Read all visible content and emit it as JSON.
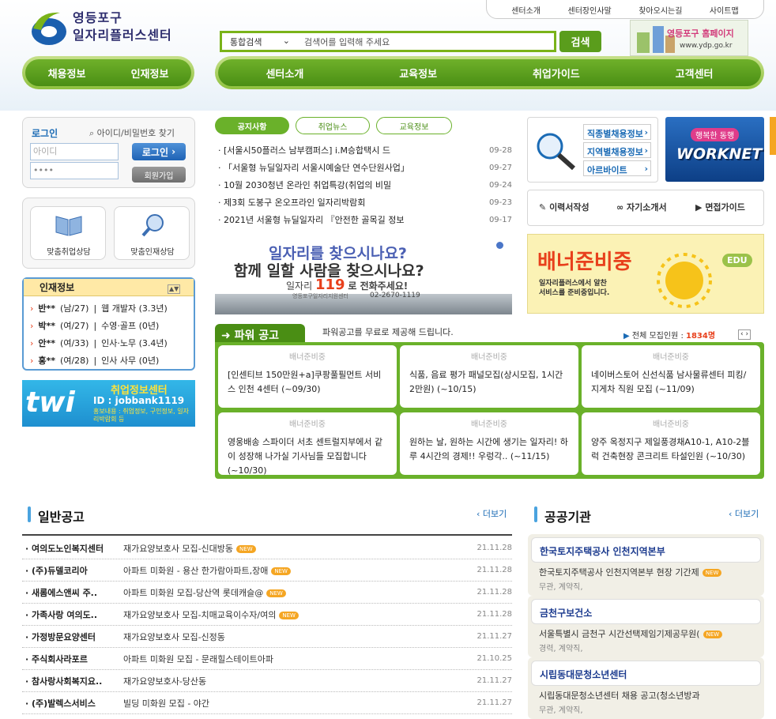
{
  "top_links": [
    "센터소개",
    "센터장인사말",
    "찾아오시는길",
    "사이트맵"
  ],
  "logo": {
    "line1": "영등포구",
    "line2": "일자리플러스센터"
  },
  "search": {
    "scope": "통합검색",
    "placeholder": "검색어를 입력해 주세요",
    "button": "검색"
  },
  "ydp_banner": {
    "title": "영등포구 홈페이지",
    "url": "www.ydp.go.kr"
  },
  "left_nav": [
    "채용정보",
    "인재정보"
  ],
  "main_nav": [
    "센터소개",
    "교육정보",
    "취업가이드",
    "고객센터"
  ],
  "login": {
    "title": "로그인",
    "find": "아이디/비밀번호 찾기",
    "id_placeholder": "아이디",
    "pw_value": "••••",
    "login_btn": "로그인",
    "join_btn": "회원가입"
  },
  "quick": [
    {
      "label": "맞춤취업상담"
    },
    {
      "label": "맞춤인재상담"
    }
  ],
  "talent": {
    "title": "인재정보",
    "items": [
      {
        "name": "반**",
        "info": "(남/27)",
        "job": "웹 개발자 (3.3년)"
      },
      {
        "name": "박**",
        "info": "(여/27)",
        "job": "수영·골프 (0년)"
      },
      {
        "name": "안**",
        "info": "(여/33)",
        "job": "인사·노무 (3.4년)"
      },
      {
        "name": "홍**",
        "info": "(여/28)",
        "job": "인사 사무 (0년)"
      }
    ]
  },
  "twitter_banner": {
    "line1": "취업정보센터",
    "line2": "ID : jobbank1119",
    "line3": "홍보내용 : 취업정보, 구인정보, 일자리박람회 등",
    "logo": "twi"
  },
  "news_tabs": [
    "공지사항",
    "취업뉴스",
    "교육정보"
  ],
  "news": [
    {
      "title": "[서울시50플러스 남부캠퍼스] i.M승합택시 드",
      "date": "09-28"
    },
    {
      "title": "「서울형 뉴딜일자리 서울시예술단 연수단원사업」",
      "date": "09-27"
    },
    {
      "title": "10월 2030청년 온라인 취업특강(취업의 비밀",
      "date": "09-24"
    },
    {
      "title": "제3회 도봉구 온오프라인 일자리박람회",
      "date": "09-23"
    },
    {
      "title": "2021년 서울형 뉴딜일자리 『안전한 골목길 정보",
      "date": "09-17"
    }
  ],
  "center_banner": {
    "line1": "일자리를 찾으시나요?",
    "line2": "함께 일할 사람을 찾으시나요?",
    "line3a": "일자리",
    "line3b": "119",
    "line3c": "로 전화주세요!",
    "line4": "영등포구일자리지원센터",
    "phone": "02-2670-1119"
  },
  "job_links": [
    "직종별채용정보",
    "지역별채용정보",
    "아르바이트"
  ],
  "worknet": {
    "small": "행복한 동행",
    "big": "WORKNET"
  },
  "guides": [
    "이력서작성",
    "자기소개서",
    "면접가이드"
  ],
  "side_banner": {
    "title": "배너준비중",
    "desc1": "일자리플러스에서 알찬",
    "desc2": "서비스를 준비중입니다.",
    "badge": "EDU"
  },
  "power": {
    "title": "파워 공고",
    "desc": "파워공고를 무료로 제공해 드립니다.",
    "total_label": "전체 모집인원 :",
    "total_value": "1834명",
    "placeholder": "배너준비중",
    "cards": [
      "[인센티브 150만원+a]쿠팡풀필먼트 서비스 인천 4센터 (~09/30)",
      "식품, 음료 평가 패널모집(상시모집, 1시간 2만원) (~10/15)",
      "네이버스토어 신선식품 남사물류센터 피킹/지게차 직원 모집 (~11/09)",
      "영웅배송 스파이더 서초 센트럴지부에서 같이 성장해 나가실 기사님들 모집합니다 (~10/30)",
      "원하는 날, 원하는 시간에 생기는 일자리! 하루 4시간의 경제!! 우렁각.. (~11/15)",
      "양주 옥정지구 제일풍경채A10-1, A10-2블럭 건축현장 콘크리트 타설인원 (~10/30)"
    ]
  },
  "general": {
    "title": "일반공고",
    "more": "더보기",
    "rows": [
      {
        "company": "여의도노인복지센터",
        "title": "재가요양보호사 모집-신대방동",
        "new": true,
        "date": "21.11.28"
      },
      {
        "company": "(주)듀델코리아",
        "title": "아파트 미화원 - 용산 한가람아파트,장애",
        "new": true,
        "date": "21.11.28"
      },
      {
        "company": "새롬에스앤씨 주..",
        "title": "아파트 미화원 모집-당산역 롯데캐슬@",
        "new": true,
        "date": "21.11.28"
      },
      {
        "company": "가족사랑 여의도..",
        "title": "재가요양보호사 모집-치매교육이수자/여의",
        "new": true,
        "date": "21.11.28"
      },
      {
        "company": "가정방문요양센터",
        "title": "재가요양보호사 모집-신정동",
        "new": false,
        "date": "21.11.27"
      },
      {
        "company": "주식회사라포르",
        "title": "아파트 미화원 모집 - 문래힐스테이트아파",
        "new": false,
        "date": "21.10.25"
      },
      {
        "company": "참사랑사회복지요..",
        "title": "재가요양보호사-당산동",
        "new": false,
        "date": "21.11.27"
      },
      {
        "company": "(주)발렉스서비스",
        "title": "빌딩 미화원 모집 - 야간",
        "new": false,
        "date": "21.11.27"
      }
    ],
    "new_label": "NEW"
  },
  "public": {
    "title": "공공기관",
    "more": "더보기",
    "items": [
      {
        "name": "한국토지주택공사 인천지역본부",
        "desc": "한국토지주택공사 인천지역본부 현장 기간제",
        "meta": "무관, 계약직,",
        "new": true
      },
      {
        "name": "금천구보건소",
        "desc": "서울특별시 금천구 시간선택제임기제공무원(",
        "meta": "경력, 계약직,",
        "new": true
      },
      {
        "name": "시립동대문청소년센터",
        "desc": "시립동대문청소년센터 채용 공고(청소년방과",
        "meta": "무관, 계약직,",
        "new": false
      }
    ]
  },
  "colors": {
    "green": "#6ab12a",
    "dark_green": "#4a8e14",
    "blue": "#1b6bb5",
    "orange": "#f5a623",
    "red": "#e8401c"
  }
}
